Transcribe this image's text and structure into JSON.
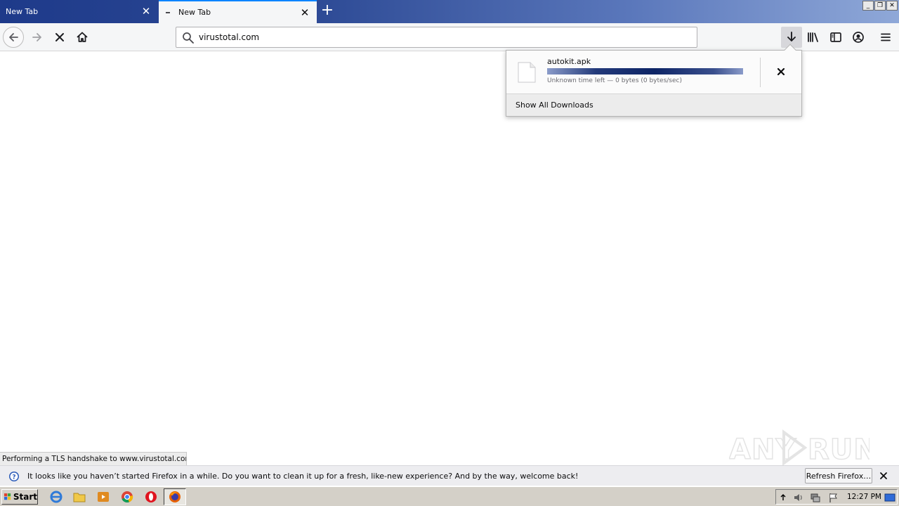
{
  "tabs": [
    {
      "label": "New Tab",
      "state": "inactive"
    },
    {
      "label": "New Tab",
      "state": "active"
    }
  ],
  "window_controls": {
    "minimize": "_",
    "restore": "❐",
    "close": "✕"
  },
  "url_bar": {
    "value": "virustotal.com"
  },
  "downloads_panel": {
    "filename": "autokit.apk",
    "status": "Unknown time left — 0 bytes (0 bytes/sec)",
    "progress_fraction": 1.0,
    "footer_label": "Show All Downloads"
  },
  "status_panel": {
    "text": "Performing a TLS handshake to www.virustotal.com..."
  },
  "notification": {
    "text": "It looks like you haven’t started Firefox in a while. Do you want to clean it up for a fresh, like-new experience? And by the way, welcome back!",
    "button_label": "Refresh Firefox…"
  },
  "watermark": {
    "text": "ANY RUN"
  },
  "taskbar": {
    "start_label": "Start",
    "apps": [
      "internet-explorer-icon",
      "folder-icon",
      "media-player-icon",
      "chrome-icon",
      "opera-icon",
      "firefox-icon"
    ],
    "clock": "12:27 PM"
  },
  "colors": {
    "tabstrip_start": "#1e3a8a",
    "tabstrip_end": "#8fa8d8",
    "toolbar": "#f5f6f7",
    "progress": "#0e2566",
    "taskbar": "#d4d0c8"
  }
}
